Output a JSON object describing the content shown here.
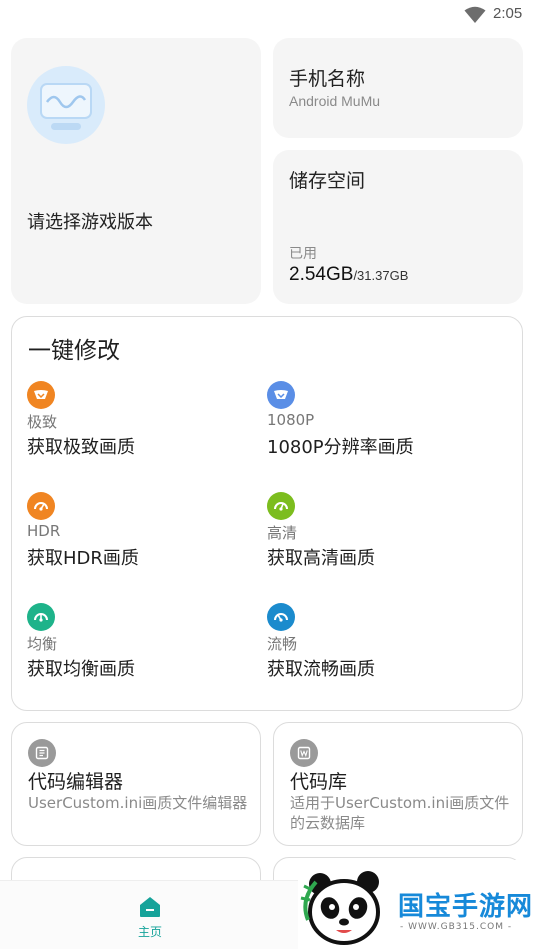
{
  "status_bar": {
    "time": "2:05",
    "wifi_icon": "wifi-icon"
  },
  "version_card": {
    "label": "请选择游戏版本",
    "avatar_icon": "game-version-avatar-icon"
  },
  "phone_card": {
    "title": "手机名称",
    "value": "Android MuMu"
  },
  "storage_card": {
    "title": "储存空间",
    "used_label": "已用",
    "used": "2.54GB",
    "total": "/31.37GB"
  },
  "one_key": {
    "title": "一键修改",
    "presets": [
      {
        "tag": "极致",
        "label": "获取极致画质",
        "icon": "extreme-quality-icon",
        "color": "#f08522"
      },
      {
        "tag": "1080P",
        "label": "1080P分辨率画质",
        "icon": "resolution-1080p-icon",
        "color": "#5a8ee6"
      },
      {
        "tag": "HDR",
        "label": "获取HDR画质",
        "icon": "hdr-quality-icon",
        "color": "#f08522"
      },
      {
        "tag": "高清",
        "label": "获取高清画质",
        "icon": "hd-quality-icon",
        "color": "#7cbd1e"
      },
      {
        "tag": "均衡",
        "label": "获取均衡画质",
        "icon": "balanced-quality-icon",
        "color": "#1eb38a"
      },
      {
        "tag": "流畅",
        "label": "获取流畅画质",
        "icon": "smooth-quality-icon",
        "color": "#1b8bcd"
      }
    ]
  },
  "tools": [
    {
      "title": "代码编辑器",
      "desc": "UserCustom.ini画质文件编辑器",
      "icon": "code-editor-icon"
    },
    {
      "title": "代码库",
      "desc": "适用于UserCustom.ini画质文件的云数据库",
      "icon": "code-library-icon"
    }
  ],
  "nav": {
    "home_label": "主页",
    "home_icon": "home-icon",
    "accent": "#16a39a"
  },
  "watermark": {
    "title": "国宝手游网",
    "url": "- WWW.GB315.COM -"
  }
}
